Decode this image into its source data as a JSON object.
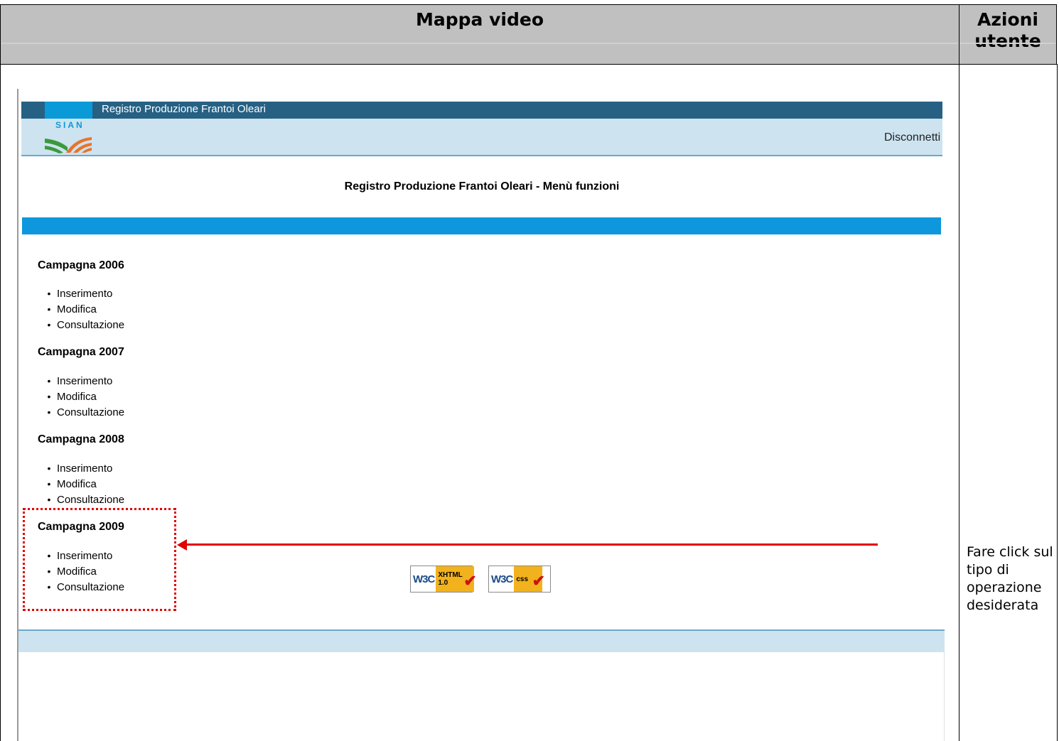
{
  "header": {
    "left_title": "Mappa video",
    "right_title_line1": "Azioni",
    "right_title_line2": "utente"
  },
  "app": {
    "title": "Registro Produzione Frantoi Oleari",
    "logo_text": "SIAN",
    "logout_label": "Disconnetti",
    "menu_title": "Registro Produzione Frantoi Oleari - Menù funzioni"
  },
  "campaigns": [
    {
      "title": "Campagna 2006",
      "items": [
        "Inserimento",
        "Modifica",
        "Consultazione"
      ]
    },
    {
      "title": "Campagna 2007",
      "items": [
        "Inserimento",
        "Modifica",
        "Consultazione"
      ]
    },
    {
      "title": "Campagna 2008",
      "items": [
        "Inserimento",
        "Modifica",
        "Consultazione"
      ]
    },
    {
      "title": "Campagna 2009",
      "items": [
        "Inserimento",
        "Modifica",
        "Consultazione"
      ]
    }
  ],
  "badges": [
    {
      "w3c": "W3C",
      "line1": "XHTML",
      "line2": "1.0",
      "icon": "checkmark-icon"
    },
    {
      "w3c": "W3C",
      "line1": "css",
      "line2": "",
      "icon": "checkmark-icon"
    }
  ],
  "note": {
    "text": "Fare click sul tipo di operazione desiderata"
  },
  "colors": {
    "header_bg": "#c0c0c0",
    "top_bar": "#266184",
    "sub_bar": "#cde3f0",
    "blue_band": "#0e97dc",
    "annotation": "#e00000"
  }
}
